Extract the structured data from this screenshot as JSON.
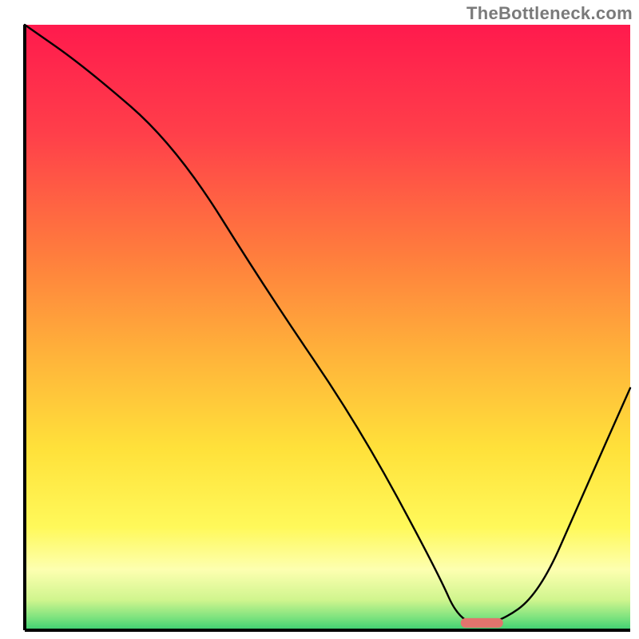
{
  "watermark": "TheBottleneck.com",
  "chart_data": {
    "type": "line",
    "title": "",
    "xlabel": "",
    "ylabel": "",
    "xlim": [
      0,
      100
    ],
    "ylim": [
      0,
      100
    ],
    "grid": false,
    "legend": false,
    "x": [
      0,
      10,
      25,
      40,
      55,
      68,
      72,
      78,
      85,
      92,
      100
    ],
    "values": [
      100,
      93,
      80,
      56,
      34,
      10,
      1,
      1,
      6,
      22,
      40
    ],
    "marker": {
      "x_start": 72,
      "x_end": 79,
      "y": 1.2,
      "color": "#e2746d"
    },
    "background_gradient": {
      "stops": [
        {
          "offset": 0.0,
          "color": "#ff1a4d"
        },
        {
          "offset": 0.18,
          "color": "#ff3f4a"
        },
        {
          "offset": 0.38,
          "color": "#ff7d3d"
        },
        {
          "offset": 0.55,
          "color": "#ffb43a"
        },
        {
          "offset": 0.7,
          "color": "#ffe13a"
        },
        {
          "offset": 0.83,
          "color": "#fff95a"
        },
        {
          "offset": 0.9,
          "color": "#fdffb0"
        },
        {
          "offset": 0.95,
          "color": "#d0f58e"
        },
        {
          "offset": 0.98,
          "color": "#7ae27e"
        },
        {
          "offset": 1.0,
          "color": "#3bcf72"
        }
      ]
    },
    "axis_color": "#000000",
    "line_color": "#000000",
    "line_width": 2.4
  },
  "colors": {
    "watermark": "#7a7a7a",
    "frame_bg": "#ffffff"
  }
}
